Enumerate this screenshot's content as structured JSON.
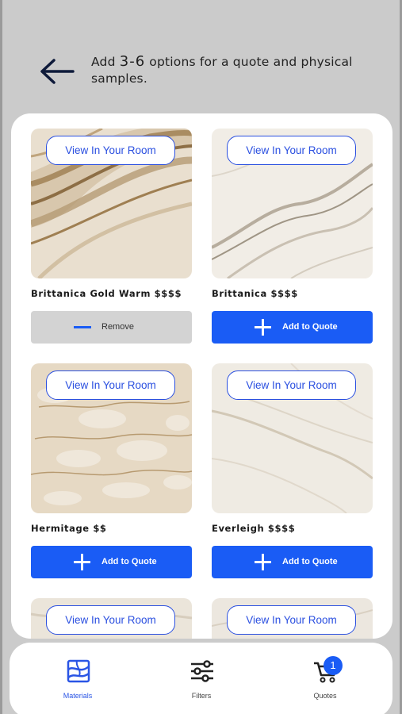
{
  "header": {
    "instruction_prefix": "Add ",
    "instruction_range": "3-6",
    "instruction_suffix": " options for a quote and physical samples."
  },
  "view_label": "View In Your Room",
  "products": [
    {
      "name": "Brittanica Gold Warm $$$$",
      "action": "Remove",
      "selected": true
    },
    {
      "name": "Brittanica $$$$",
      "action": "Add to Quote",
      "selected": false
    },
    {
      "name": "Hermitage $$",
      "action": "Add to Quote",
      "selected": false
    },
    {
      "name": "Everleigh $$$$",
      "action": "Add to Quote",
      "selected": false
    },
    {
      "name": "",
      "action": "",
      "selected": false
    },
    {
      "name": "",
      "action": "",
      "selected": false
    }
  ],
  "nav": {
    "materials": "Materials",
    "filters": "Filters",
    "quotes": "Quotes",
    "quote_count": "1",
    "active": "materials"
  },
  "colors": {
    "accent": "#1a5cf5",
    "outline_blue": "#2a4fe0",
    "remove_gray": "#d3d3d3"
  }
}
